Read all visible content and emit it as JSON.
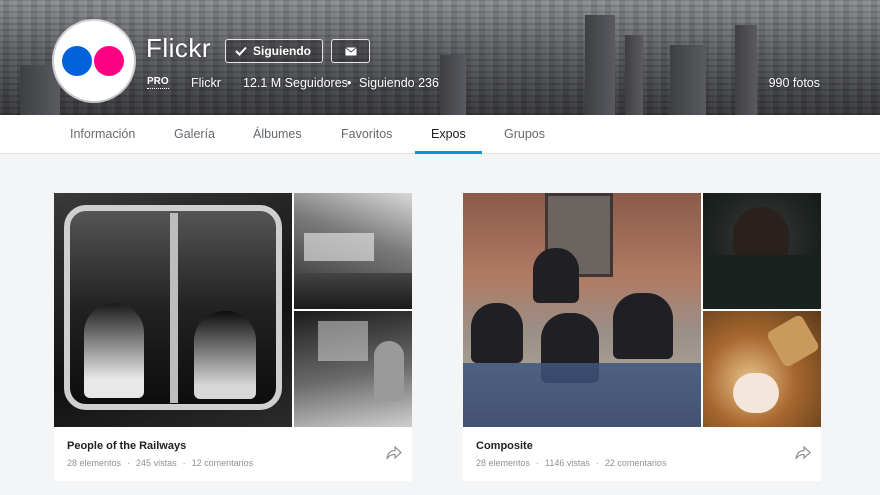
{
  "profile": {
    "name": "Flickr",
    "badge": "PRO",
    "username": "Flickr",
    "followers": "12.1 M Seguidores",
    "following": "Siguiendo 236",
    "photo_count": "990 fotos",
    "follow_button_label": "Siguiendo",
    "logo_colors": {
      "blue": "#0063dc",
      "pink": "#ff0084"
    }
  },
  "tabs": [
    {
      "label": "Información"
    },
    {
      "label": "Galería"
    },
    {
      "label": "Álbumes"
    },
    {
      "label": "Favoritos"
    },
    {
      "label": "Expos",
      "active": true
    },
    {
      "label": "Grupos"
    }
  ],
  "galleries": [
    {
      "title": "People of the Railways",
      "items": "28 elementos",
      "views": "245 vistas",
      "comments": "12 comentarios"
    },
    {
      "title": "Composite",
      "items": "28 elementos",
      "views": "1146 vistas",
      "comments": "22 comentarios"
    }
  ],
  "icons": {
    "check": "check-icon",
    "mail": "envelope-icon",
    "share": "share-arrow-icon"
  },
  "colors": {
    "accent": "#128fdc",
    "page_bg": "#f3f5f6"
  }
}
